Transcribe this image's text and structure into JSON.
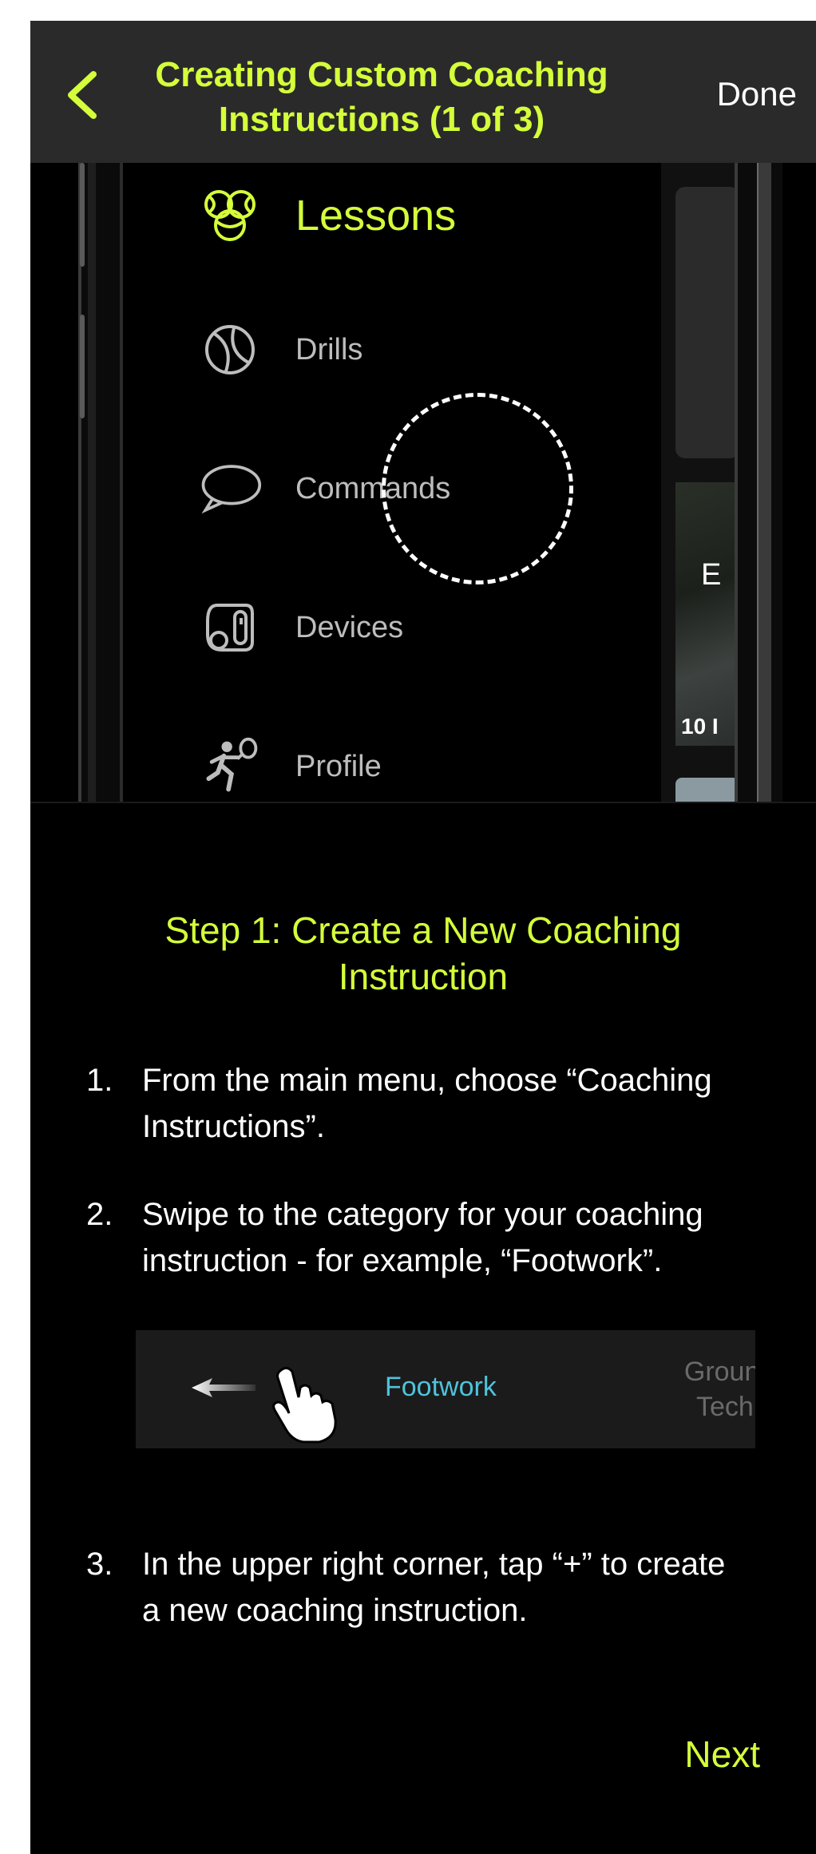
{
  "header": {
    "title_line1": "Creating Custom Coaching",
    "title_line2": "Instructions (1 of 3)",
    "done_label": "Done"
  },
  "preview": {
    "menu_items": [
      {
        "label": "Lessons",
        "icon": "tennis-balls-icon",
        "active": true
      },
      {
        "label": "Drills",
        "icon": "tennis-ball-icon",
        "active": false
      },
      {
        "label": "Commands",
        "icon": "speech-bubble-icon",
        "active": false
      },
      {
        "label": "Devices",
        "icon": "ball-machine-icon",
        "active": false
      },
      {
        "label": "Profile",
        "icon": "player-racket-icon",
        "active": false
      }
    ],
    "right_letter": "E",
    "right_count": "10 I"
  },
  "step": {
    "title_line1": "Step 1: Create a New Coaching",
    "title_line2": "Instruction",
    "instructions": [
      {
        "num": "1.",
        "text_line1": "From the main menu, choose “Coaching",
        "text_line2": "Instructions”."
      },
      {
        "num": "2.",
        "text_line1": "Swipe to the category for your coaching",
        "text_line2": "instruction - for example, “Footwork”."
      },
      {
        "num": "3.",
        "text_line1": "In the upper right corner, tap “+” to create",
        "text_line2": "a new coaching instruction."
      }
    ],
    "swipe_demo": {
      "active_category": "Footwork",
      "next_category_line1": "Ground",
      "next_category_line2": "Techni"
    }
  },
  "footer": {
    "next_label": "Next"
  },
  "colors": {
    "accent": "#d4ff3a",
    "header_bg": "#2a2a2a",
    "active_category": "#4fc3dc"
  }
}
